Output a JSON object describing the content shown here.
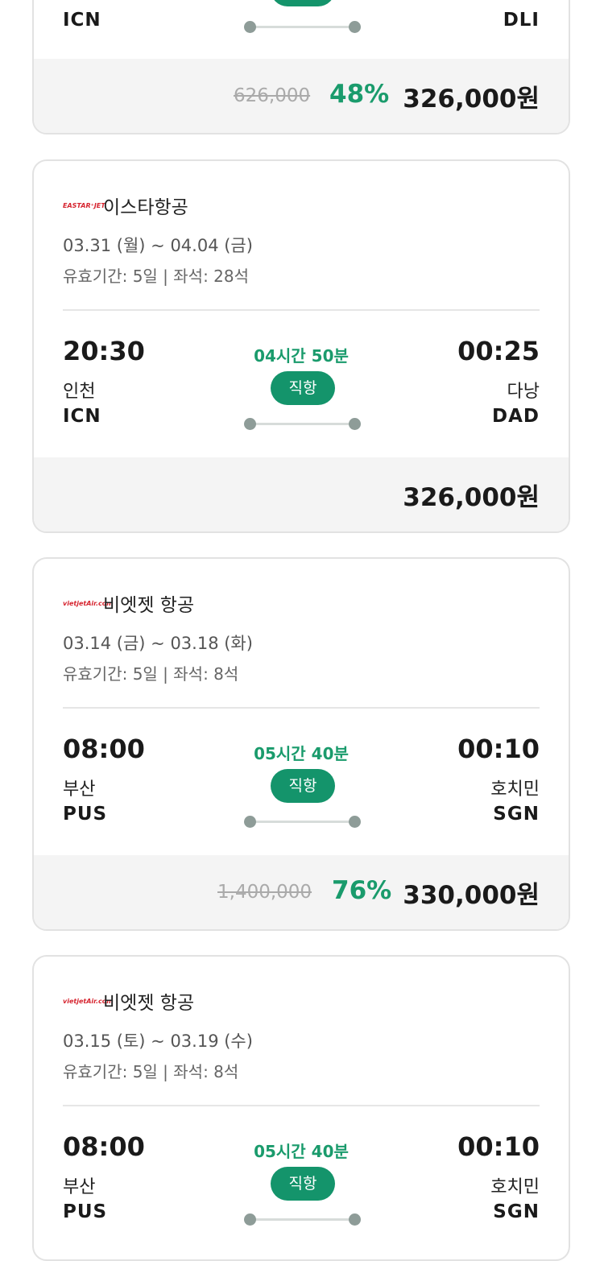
{
  "colors": {
    "accent": "#1a9b6c",
    "badge": "#14946b",
    "border": "#e2e2e2",
    "price_bg": "#f4f4f4"
  },
  "cards": [
    {
      "from_code": "ICN",
      "to_code": "DLI",
      "orig_price": "626,000",
      "discount": "48%",
      "price": "326,000원"
    },
    {
      "airline_logo": "EASTAR⁺JET",
      "airline": "이스타항공",
      "dates": "03.31 (월) ~ 04.04 (금)",
      "meta": "유효기간: 5일 | 좌석: 28석",
      "depart_time": "20:30",
      "arrive_time": "00:25",
      "duration": "04시간 50분",
      "badge": "직항",
      "from_city": "인천",
      "from_code": "ICN",
      "to_city": "다낭",
      "to_code": "DAD",
      "price": "326,000원"
    },
    {
      "airline_logo": "vietjetAir.com",
      "airline": "비엣젯 항공",
      "dates": "03.14 (금) ~ 03.18 (화)",
      "meta": "유효기간: 5일 | 좌석: 8석",
      "depart_time": "08:00",
      "arrive_time": "00:10",
      "duration": "05시간 40분",
      "badge": "직항",
      "from_city": "부산",
      "from_code": "PUS",
      "to_city": "호치민",
      "to_code": "SGN",
      "orig_price": "1,400,000",
      "discount": "76%",
      "price": "330,000원"
    },
    {
      "airline_logo": "vietjetAir.com",
      "airline": "비엣젯 항공",
      "dates": "03.15 (토) ~ 03.19 (수)",
      "meta": "유효기간: 5일 | 좌석: 8석",
      "depart_time": "08:00",
      "arrive_time": "00:10",
      "duration": "05시간 40분",
      "badge": "직항",
      "from_city": "부산",
      "from_code": "PUS",
      "to_city": "호치민",
      "to_code": "SGN"
    }
  ]
}
